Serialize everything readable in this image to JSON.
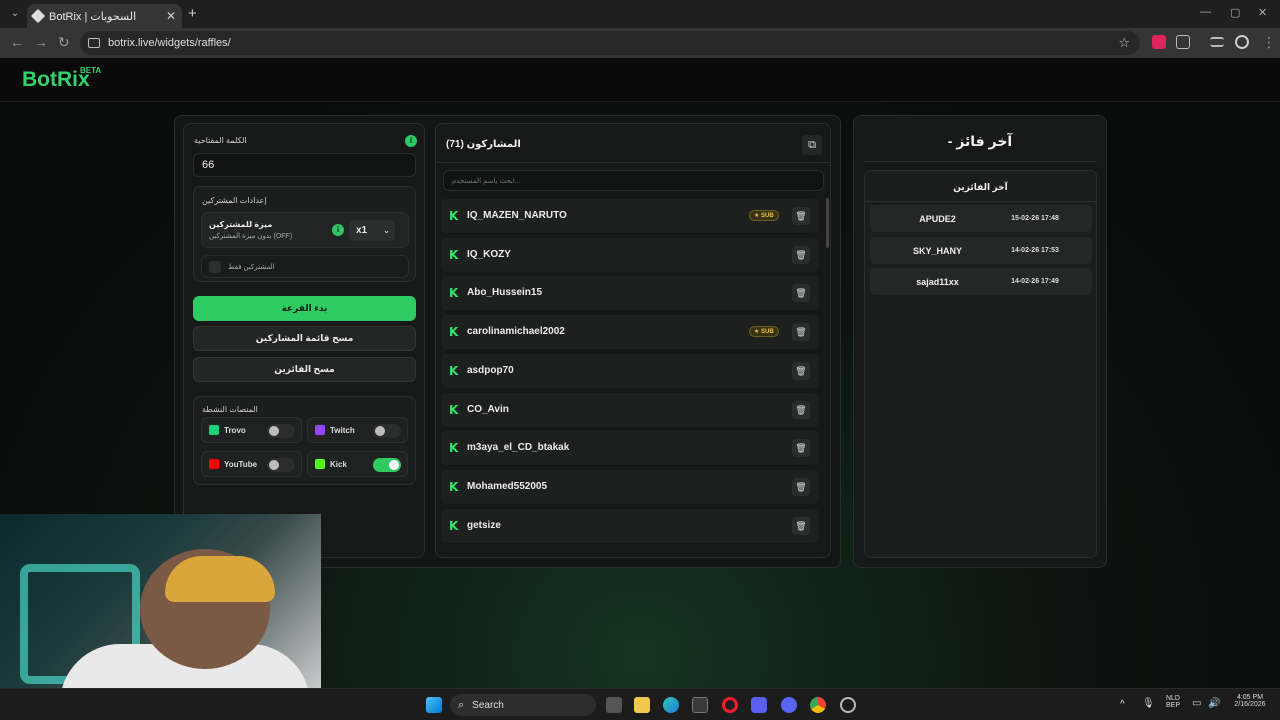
{
  "browser": {
    "tab_title": "BotRix | السحوبات",
    "url": "botrix.live/widgets/raffles/",
    "new_tab": "+",
    "close": "✕"
  },
  "app": {
    "logo": "BotRix",
    "beta": "BETA"
  },
  "settings": {
    "keyword_label": "الكلمة المفتاحية",
    "keyword_value": "66",
    "participants_settings_label": "إعدادات المشتركين",
    "sub_feature_title": "ميزة للمشتركين",
    "sub_feature_desc": "بدون ميزة المشتركين (OFF)",
    "multiplier": "x1",
    "subs_only_label": "المشتركين فقط",
    "start_button": "بدء القرعة",
    "clear_participants_button": "مسح قائمة المشاركين",
    "clear_winners_button": "مسح الفائزين",
    "platforms_label": "المنصات النشطة",
    "platforms": [
      {
        "name": "Trovo",
        "enabled": false,
        "color": "#1fd07a"
      },
      {
        "name": "Twitch",
        "enabled": false,
        "color": "#9146ff"
      },
      {
        "name": "YouTube",
        "enabled": false,
        "color": "#ff0000"
      },
      {
        "name": "Kick",
        "enabled": true,
        "color": "#53fc18"
      }
    ]
  },
  "participants": {
    "title": "المشاركون (71)",
    "search_placeholder": "ابحث باسم المستخدم...",
    "sub_badge": "SUB",
    "platform_glyph": "K",
    "rows": [
      {
        "name": "IQ_MAZEN_NARUTO",
        "sub": true
      },
      {
        "name": "IQ_KOZY",
        "sub": false
      },
      {
        "name": "Abo_Hussein15",
        "sub": false
      },
      {
        "name": "carolinamichael2002",
        "sub": true
      },
      {
        "name": "asdpop70",
        "sub": false
      },
      {
        "name": "CO_Avin",
        "sub": false
      },
      {
        "name": "m3aya_el_CD_btakak",
        "sub": false
      },
      {
        "name": "Mohamed552005",
        "sub": false
      },
      {
        "name": "getsize",
        "sub": false
      }
    ]
  },
  "winners": {
    "title": "- آخر فائز",
    "list_title": "آخر الفائزين",
    "items": [
      {
        "name": "APUDE2",
        "date": "15-02-26 17:48"
      },
      {
        "name": "SKY_HANY",
        "date": "14-02-26 17:53"
      },
      {
        "name": "sajad11xx",
        "date": "14-02-26 17:49"
      }
    ]
  },
  "taskbar": {
    "search_placeholder": "Search",
    "lang_top": "NLD",
    "lang_bottom": "BEP",
    "time": "4:05 PM",
    "date": "2/16/2026"
  }
}
